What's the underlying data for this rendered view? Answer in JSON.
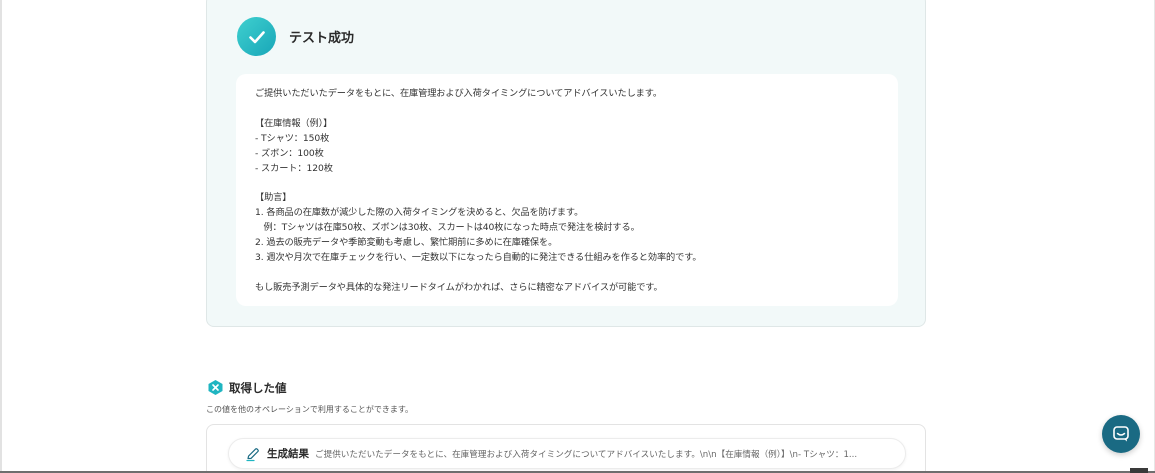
{
  "success": {
    "title": "テスト成功",
    "body": "ご提供いただいたデータをもとに、在庫管理および入荷タイミングについてアドバイスいたします。\n\n【在庫情報（例）】\n- Tシャツ：150枚\n- ズボン：100枚\n- スカート：120枚\n\n【助言】\n1. 各商品の在庫数が減少した際の入荷タイミングを決めると、欠品を防げます。\n   例：Tシャツは在庫50枚、ズボンは30枚、スカートは40枚になった時点で発注を検討する。\n2. 過去の販売データや季節変動も考慮し、繁忙期前に多めに在庫確保を。\n3. 週次や月次で在庫チェックを行い、一定数以下になったら自動的に発注できる仕組みを作ると効率的です。\n\nもし販売予測データや具体的な発注リードタイムがわかれば、さらに精密なアドバイスが可能です。"
  },
  "acquired": {
    "title": "取得した値",
    "description": "この値を他のオペレーションで利用することができます。",
    "items": [
      {
        "label": "生成結果",
        "value": "ご提供いただいたデータをもとに、在庫管理および入荷タイミングについてアドバイスいたします。\\n\\n【在庫情報（例）】\\n- Tシャツ：1..."
      }
    ]
  },
  "colors": {
    "accent": "#1fb5c1",
    "card_bg": "#f2f9f9",
    "chat_button": "#1a6a83"
  },
  "icons": {
    "success": "check-icon",
    "acquired": "x-badge-icon",
    "value": "pen-icon",
    "chat": "chat-bubble-icon"
  }
}
